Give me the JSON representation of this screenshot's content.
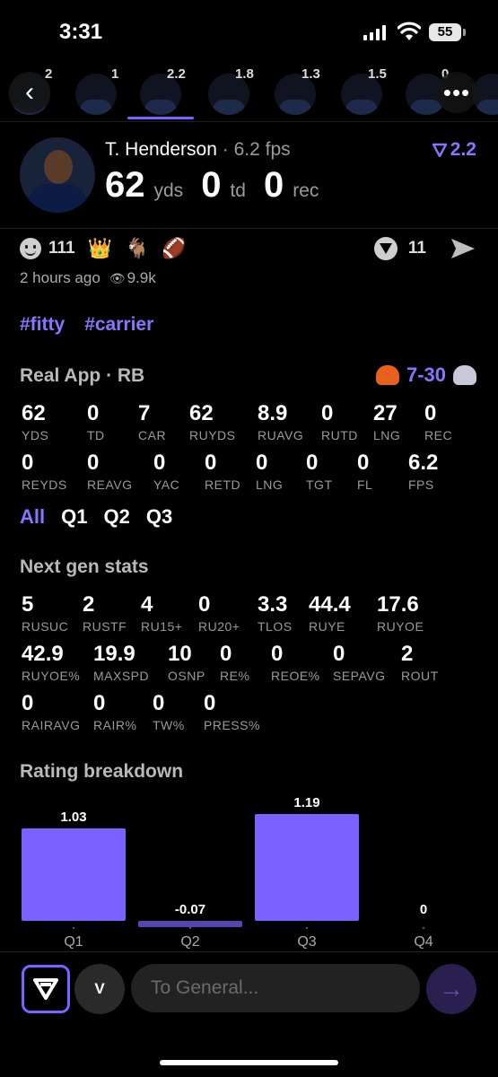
{
  "status_bar": {
    "time": "3:31",
    "battery": "55"
  },
  "strip": {
    "items": [
      {
        "score": "2"
      },
      {
        "score": "1"
      },
      {
        "score": "2.2"
      },
      {
        "score": "1.8"
      },
      {
        "score": "1.3"
      },
      {
        "score": "1.5"
      },
      {
        "score": "0"
      },
      {
        "score": ""
      }
    ],
    "selected_index": 2
  },
  "player": {
    "name": "T. Henderson",
    "fps": "· 6.2 fps",
    "rating": "2.2",
    "yds": "62",
    "yds_unit": "yds",
    "td": "0",
    "td_unit": "td",
    "rec": "0",
    "rec_unit": "rec"
  },
  "reactions": {
    "count": "111",
    "comment_count": "11",
    "time_ago": "2 hours ago",
    "views": "9.9k"
  },
  "hashtags": [
    "#fitty",
    "#carrier"
  ],
  "real_app": {
    "title": "Real App · RB",
    "score": "7-30",
    "colors": {
      "accent": "#8a73ff",
      "home_helmet": "#e8611a",
      "away_helmet": "#c8c8d8"
    }
  },
  "stats_row1": [
    {
      "v": "62",
      "l": "YDS"
    },
    {
      "v": "0",
      "l": "TD"
    },
    {
      "v": "7",
      "l": "CAR"
    },
    {
      "v": "62",
      "l": "RUYDS"
    },
    {
      "v": "8.9",
      "l": "RUAVG"
    },
    {
      "v": "0",
      "l": "RUTD"
    },
    {
      "v": "27",
      "l": "LNG"
    },
    {
      "v": "0",
      "l": "REC"
    }
  ],
  "stats_row2": [
    {
      "v": "0",
      "l": "REYDS"
    },
    {
      "v": "0",
      "l": "REAVG"
    },
    {
      "v": "0",
      "l": "YAC"
    },
    {
      "v": "0",
      "l": "RETD"
    },
    {
      "v": "0",
      "l": "LNG"
    },
    {
      "v": "0",
      "l": "TGT"
    },
    {
      "v": "0",
      "l": "FL"
    },
    {
      "v": "6.2",
      "l": "FPS"
    }
  ],
  "tabs": [
    "All",
    "Q1",
    "Q2",
    "Q3"
  ],
  "next_gen": {
    "title": "Next gen stats",
    "row1": [
      {
        "v": "5",
        "l": "RUSUC"
      },
      {
        "v": "2",
        "l": "RUSTF"
      },
      {
        "v": "4",
        "l": "RU15+"
      },
      {
        "v": "0",
        "l": "RU20+"
      },
      {
        "v": "3.3",
        "l": "TLOS"
      },
      {
        "v": "44.4",
        "l": "RUYE"
      },
      {
        "v": "17.6",
        "l": "RUYOE"
      }
    ],
    "row2": [
      {
        "v": "42.9",
        "l": "RUYOE%"
      },
      {
        "v": "19.9",
        "l": "MAXSPD"
      },
      {
        "v": "10",
        "l": "OSNP"
      },
      {
        "v": "0",
        "l": "RE%"
      },
      {
        "v": "0",
        "l": "REOE%"
      },
      {
        "v": "0",
        "l": "SEPAVG"
      },
      {
        "v": "2",
        "l": "ROUT"
      }
    ],
    "row3": [
      {
        "v": "0",
        "l": "RAIRAVG"
      },
      {
        "v": "0",
        "l": "RAIR%"
      },
      {
        "v": "0",
        "l": "TW%"
      },
      {
        "v": "0",
        "l": "PRESS%"
      }
    ]
  },
  "rating_breakdown": {
    "title": "Rating breakdown"
  },
  "chart_data": {
    "type": "bar",
    "categories": [
      "Q1",
      "Q2",
      "Q3",
      "Q4"
    ],
    "values": [
      1.03,
      -0.07,
      1.19,
      0
    ],
    "labels": [
      "1.03",
      "-0.07",
      "1.19",
      "0"
    ],
    "color": "#7b61ff",
    "title": "",
    "xlabel": "",
    "ylabel": ""
  },
  "composer": {
    "avatar_letter": "V",
    "placeholder": "To General..."
  }
}
